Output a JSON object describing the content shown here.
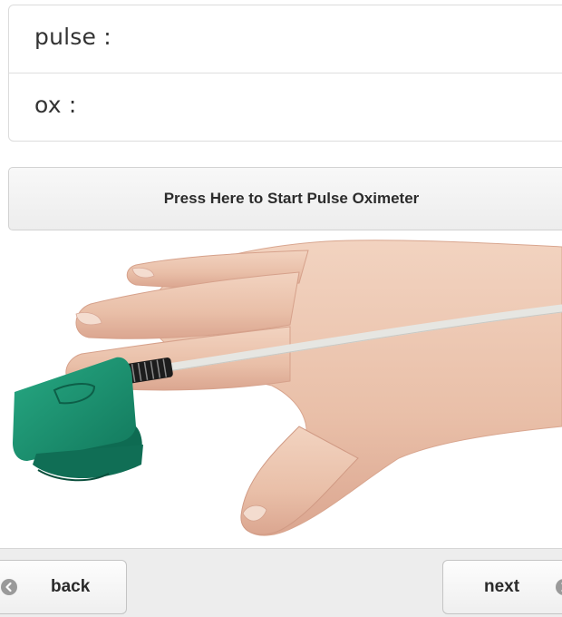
{
  "readings": {
    "pulse_label": "pulse :",
    "ox_label": "ox :"
  },
  "start_button": {
    "label": "Press Here to Start Pulse Oximeter"
  },
  "illustration": {
    "subject": "hand-with-finger-pulse-oximeter",
    "clip_color": "#1f9a78"
  },
  "footer": {
    "back_label": "back",
    "back_icon": "arrow-left-circle-icon",
    "next_label": "next",
    "next_icon": "arrow-right-circle-icon"
  }
}
